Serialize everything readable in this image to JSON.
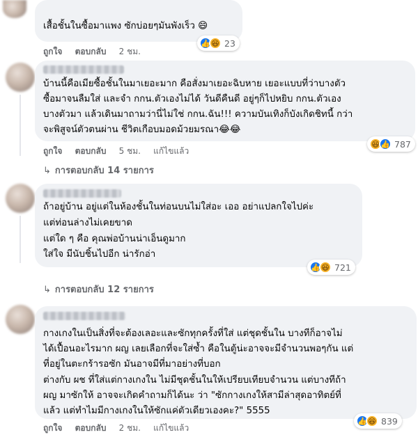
{
  "ui": {
    "like": "ถูกใจ",
    "reply": "ตอบกลับ",
    "edited": "แก้ไขแล้ว"
  },
  "comments": [
    {
      "lines": [
        "เสื้อชั้นในซื้อมาแพง ซักบ่อยๆมันพังเร็ว 😄"
      ],
      "time": "2 ชม.",
      "reactions": "23",
      "edited": false
    },
    {
      "lines": [
        "บ้านนี้คือเมียซื้อชั้นในมาเยอะมาก คือสั่งมาเยอะฉิบหาย เยอะแบบที่ว่าบางตัว",
        "ซื้อมาจนลืมใส่ และจำ กกน.ตัวเองไม่ได้ วันดีคืนดี อยู่ๆก็ไปหยิบ กกน.ตัวเอง",
        "บางตัวมา แล้วเดินมาถามว่านี่ไม่ใช่ กกน.ฉัน!!! ความบันเทิงก็บังเกิดชิทนี้ กว่า",
        "จะพิสูจน์ตัวตนผ่าน ชีวิตเกือบมอดม้วยมรณา😂😂"
      ],
      "time": "5 ชม.",
      "reactions": "787",
      "edited": true,
      "replies": "การตอบกลับ 14 รายการ"
    },
    {
      "lines": [
        "ถ้าอยู่บ้าน อยู่แต่ในห้องชั้นในท่อนบนไม่ใส่อะ เออ อย่าแปลกใจไปค่ะ",
        "แต่ท่อนล่างไม่เคยขาด",
        "แต่ใด ๆ คือ คุณพ่อบ้านน่าเอ็นดูมาก",
        "ใส่ใจ มีนับชิ้นไปอีก น่ารักอ่า"
      ],
      "time": "",
      "reactions": "721",
      "edited": false,
      "replies": "การตอบกลับ 12 รายการ"
    },
    {
      "lines": [
        "กางเกงในเป็นสิ่งที่จะต้องเลอะและซักทุกครั้งที่ใส่ แต่ชุดชั้นใน บางทีก็อาจไม่",
        "ได้เปื้อนอะไรมาก ผญ เลยเลือกที่จะใส่ซ้ำ คือในตู้น่ะอาจจะมีจำนวนพอๆกัน แต่",
        "ที่อยู่ในตะกร้ารอซัก มันอาจมีที่มาอย่างที่บอก",
        "ต่างกับ ผช ที่ใส่แต่กางเกงใน ไม่มีชุดชั้นในให้เปรียบเทียบจำนวน แต่บางทีถ้า",
        "ผญ มาซักให้ อาจจะเกิดคำถามก็ได้นะ ว่า \"ซักกางเกงให้สามีล่าสุดอาทิตย์ที่",
        "แล้ว แต่ทำไมมีกางเกงในให้ซักแค่ตัวเดียวเองคะ?\" 5555"
      ],
      "time": "2 ชม.",
      "reactions": "839",
      "edited": true
    }
  ]
}
